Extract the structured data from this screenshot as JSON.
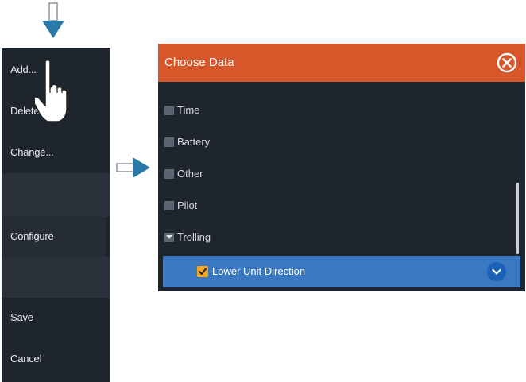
{
  "menu": {
    "items": [
      {
        "label": "Add..."
      },
      {
        "label": "Delete"
      },
      {
        "label": "Change..."
      },
      {
        "label": ""
      },
      {
        "label": "Configure"
      },
      {
        "label": ""
      },
      {
        "label": "Save"
      },
      {
        "label": "Cancel"
      }
    ]
  },
  "dialog": {
    "title": "Choose Data",
    "rows": [
      {
        "label": "Time"
      },
      {
        "label": "Battery"
      },
      {
        "label": "Other"
      },
      {
        "label": "Pilot"
      },
      {
        "label": "Trolling"
      }
    ],
    "selected": {
      "label": "Lower Unit Direction",
      "checked": true
    }
  },
  "colors": {
    "header": "#d8572a",
    "panel": "#1f252d",
    "selection": "#3a78c2",
    "arrow": "#2a7aa8",
    "checkbox": "#f5a623"
  },
  "icons": {
    "pointer": "hand-pointer-icon",
    "down_arrow": "arrow-down-icon",
    "right_arrow": "arrow-right-icon",
    "close": "close-circle-icon",
    "dropdown": "chevron-down-icon"
  }
}
